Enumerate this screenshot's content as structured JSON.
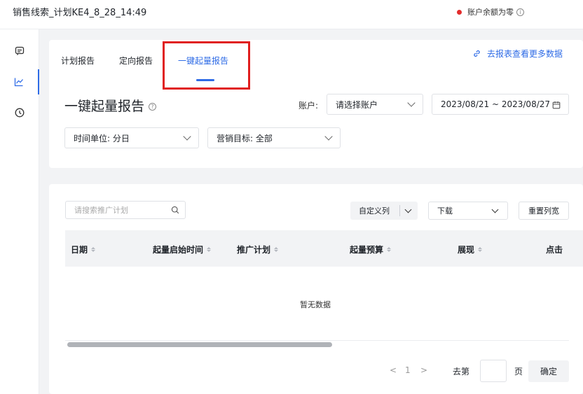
{
  "header": {
    "title": "销售线索_计划KE4_8_28_14:49",
    "balance_notice": "账户余额为零",
    "status_color": "#e32c2c"
  },
  "rail": {
    "items": [
      {
        "icon": "message-square-icon"
      },
      {
        "icon": "line-chart-icon",
        "active": true
      },
      {
        "icon": "clock-icon"
      }
    ]
  },
  "tabs": [
    {
      "label": "计划报告"
    },
    {
      "label": "定向报告"
    },
    {
      "label": "一键起量报告",
      "active": true
    }
  ],
  "report_link": "去报表查看更多数据",
  "page_title": "一键起量报告",
  "filters": {
    "account_label": "账户:",
    "account_placeholder": "请选择账户",
    "date_range": "2023/08/21 ~ 2023/08/27",
    "time_unit": "时间单位: 分日",
    "marketing_goal": "营销目标: 全部"
  },
  "toolbar": {
    "search_placeholder": "请搜索推广计划",
    "custom_columns": "自定义列",
    "download": "下载",
    "reset_width": "重置列宽"
  },
  "table": {
    "columns": [
      "日期",
      "起量启始时间",
      "推广计划",
      "起量预算",
      "展现",
      "点击"
    ],
    "empty_text": "暂无数据"
  },
  "pagination": {
    "prev": "<",
    "current_page": "1",
    "next": ">",
    "goto_label": "去第",
    "page_unit": "页",
    "confirm": "确定"
  },
  "colors": {
    "accent": "#2e6be6",
    "highlight_box": "#e01e1e"
  }
}
